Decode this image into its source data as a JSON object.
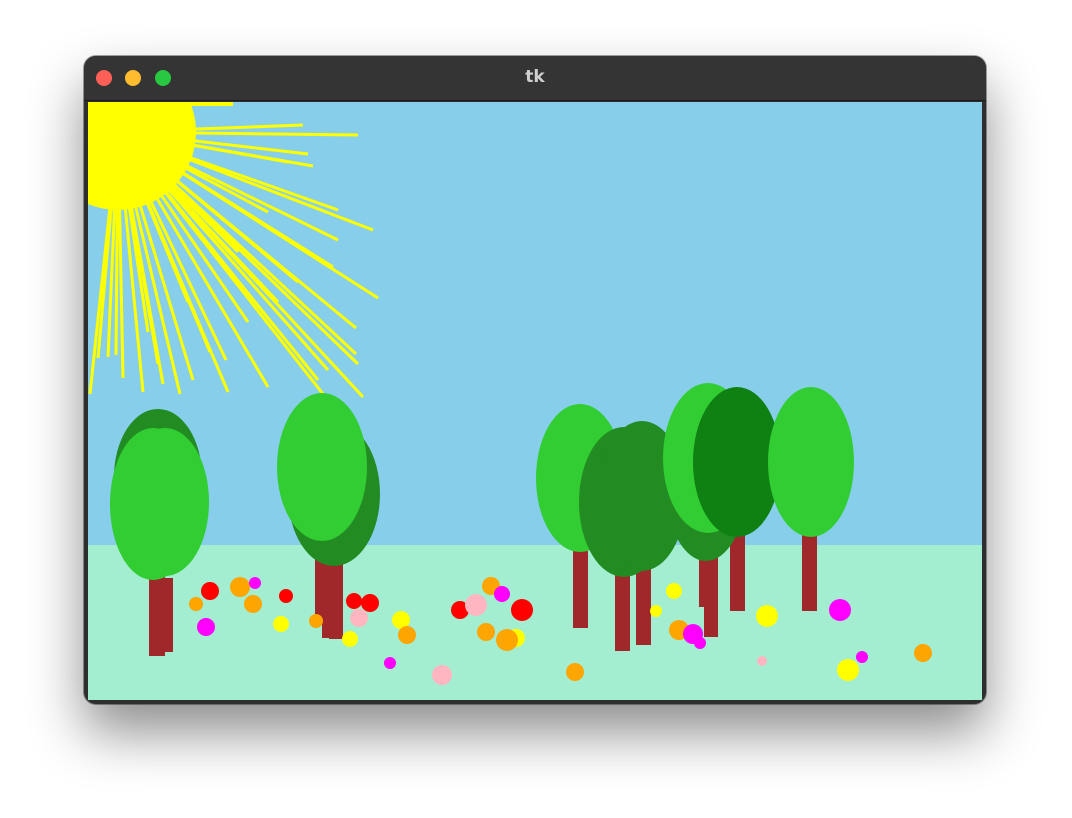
{
  "window": {
    "title": "tk",
    "controls": [
      "close-button",
      "minimize-button",
      "zoom-button"
    ]
  },
  "scene": {
    "sky_color": "#87ceeb",
    "ground_color": "#a3eed0",
    "sun_color": "#ffff00",
    "tree_colors": [
      "#32cd32",
      "#228b22",
      "#0f8012"
    ],
    "trunk_color": "#a0282a",
    "flower_colors": [
      "#ff0000",
      "#ffa500",
      "#ff00ff",
      "#ffff00",
      "#ffb6c1"
    ]
  }
}
